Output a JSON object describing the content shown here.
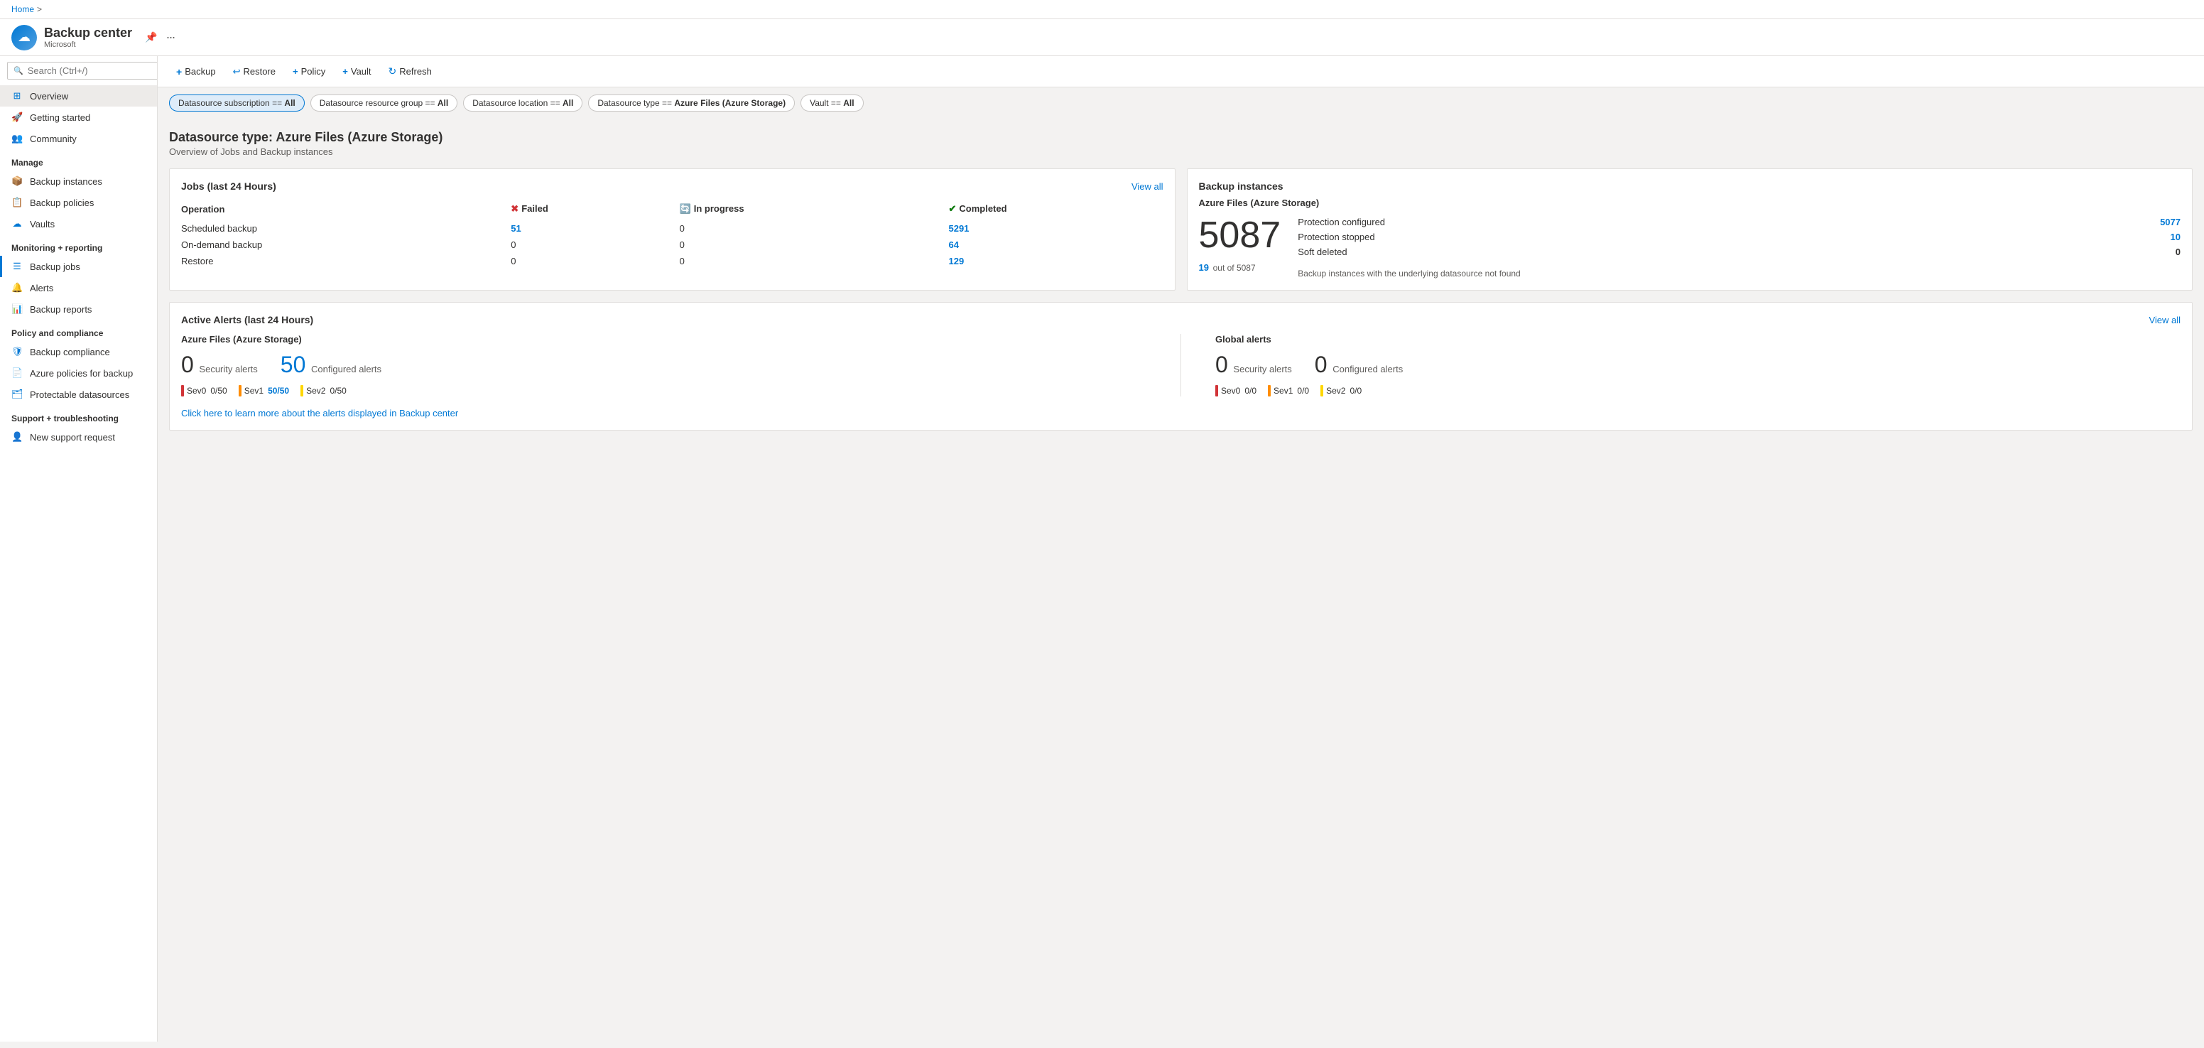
{
  "app": {
    "logo_text": "☁",
    "title": "Backup center",
    "subtitle": "Microsoft",
    "pin_icon": "📌",
    "more_icon": "···"
  },
  "breadcrumb": {
    "home": "Home",
    "separator": ">"
  },
  "sidebar": {
    "search_placeholder": "Search (Ctrl+/)",
    "collapse_icon": "«",
    "nav_items": [
      {
        "id": "overview",
        "label": "Overview",
        "icon": "grid",
        "active": true
      },
      {
        "id": "getting-started",
        "label": "Getting started",
        "icon": "rocket"
      },
      {
        "id": "community",
        "label": "Community",
        "icon": "people"
      }
    ],
    "manage_label": "Manage",
    "manage_items": [
      {
        "id": "backup-instances",
        "label": "Backup instances",
        "icon": "box"
      },
      {
        "id": "backup-policies",
        "label": "Backup policies",
        "icon": "policy"
      },
      {
        "id": "vaults",
        "label": "Vaults",
        "icon": "cloud"
      }
    ],
    "monitoring_label": "Monitoring + reporting",
    "monitoring_items": [
      {
        "id": "backup-jobs",
        "label": "Backup jobs",
        "icon": "jobs",
        "selected": true
      },
      {
        "id": "alerts",
        "label": "Alerts",
        "icon": "alert"
      },
      {
        "id": "backup-reports",
        "label": "Backup reports",
        "icon": "report"
      }
    ],
    "policy_label": "Policy and compliance",
    "policy_items": [
      {
        "id": "backup-compliance",
        "label": "Backup compliance",
        "icon": "compliance"
      },
      {
        "id": "azure-policies",
        "label": "Azure policies for backup",
        "icon": "policy2"
      },
      {
        "id": "protectable-datasources",
        "label": "Protectable datasources",
        "icon": "datasource"
      }
    ],
    "support_label": "Support + troubleshooting",
    "support_items": [
      {
        "id": "new-support-request",
        "label": "New support request",
        "icon": "support"
      }
    ]
  },
  "toolbar": {
    "backup_label": "+ Backup",
    "restore_label": "↩ Restore",
    "policy_label": "+ Policy",
    "vault_label": "+ Vault",
    "refresh_label": "↻ Refresh"
  },
  "filters": {
    "chips": [
      {
        "id": "subscription",
        "label": "Datasource subscription == All",
        "selected": true
      },
      {
        "id": "resource-group",
        "label": "Datasource resource group == All",
        "selected": false
      },
      {
        "id": "location",
        "label": "Datasource location == All",
        "selected": false
      },
      {
        "id": "datasource-type",
        "label": "Datasource type == Azure Files (Azure Storage)",
        "selected": false
      },
      {
        "id": "vault",
        "label": "Vault == All",
        "selected": false
      }
    ]
  },
  "main": {
    "page_title": "Datasource type: Azure Files (Azure Storage)",
    "page_subtitle": "Overview of Jobs and Backup instances",
    "jobs_card": {
      "title": "Jobs (last 24 Hours)",
      "view_all": "View all",
      "columns": [
        "Operation",
        "Failed",
        "In progress",
        "Completed"
      ],
      "rows": [
        {
          "operation": "Scheduled backup",
          "failed": "51",
          "in_progress": "0",
          "completed": "5291",
          "failed_is_blue": true,
          "completed_is_blue": true
        },
        {
          "operation": "On-demand backup",
          "failed": "0",
          "in_progress": "0",
          "completed": "64",
          "failed_is_blue": false,
          "completed_is_blue": true
        },
        {
          "operation": "Restore",
          "failed": "0",
          "in_progress": "0",
          "completed": "129",
          "failed_is_blue": false,
          "completed_is_blue": true
        }
      ]
    },
    "backup_instances_card": {
      "title": "Backup instances",
      "subtitle": "Azure Files (Azure Storage)",
      "big_number": "5087",
      "stats": [
        {
          "label": "Protection configured",
          "value": "5077",
          "is_blue": true
        },
        {
          "label": "Protection stopped",
          "value": "10",
          "is_blue": true
        },
        {
          "label": "Soft deleted",
          "value": "0",
          "is_blue": false
        }
      ],
      "underlying_num": "19",
      "underlying_text": "out of 5087",
      "underlying_desc": "Backup instances with the underlying datasource not found"
    },
    "alerts_card": {
      "title": "Active Alerts (last 24 Hours)",
      "view_all": "View all",
      "azure_files_section": "Azure Files (Azure Storage)",
      "global_section": "Global alerts",
      "azure_security_alerts_num": "0",
      "azure_security_alerts_label": "Security alerts",
      "azure_configured_alerts_num": "50",
      "azure_configured_alerts_label": "Configured alerts",
      "azure_sevs": [
        {
          "label": "Sev0",
          "value": "0/50",
          "color": "red"
        },
        {
          "label": "Sev1",
          "value": "50/50",
          "value_blue": true,
          "color": "orange"
        },
        {
          "label": "Sev2",
          "value": "0/50",
          "color": "yellow"
        }
      ],
      "global_security_alerts_num": "0",
      "global_security_alerts_label": "Security alerts",
      "global_configured_alerts_num": "0",
      "global_configured_alerts_label": "Configured alerts",
      "global_sevs": [
        {
          "label": "Sev0",
          "value": "0/0",
          "color": "red"
        },
        {
          "label": "Sev1",
          "value": "0/0",
          "color": "orange"
        },
        {
          "label": "Sev2",
          "value": "0/0",
          "color": "yellow"
        }
      ],
      "learn_more_text": "Click here to learn more about the alerts displayed in Backup center"
    }
  }
}
